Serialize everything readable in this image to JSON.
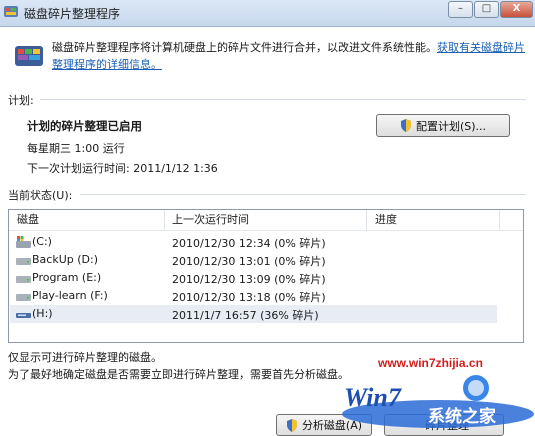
{
  "window": {
    "title": "磁盘碎片整理程序",
    "controls": {
      "minimize": "–",
      "maximize": "□",
      "close": "X"
    }
  },
  "header": {
    "description": "磁盘碎片整理程序将计算机硬盘上的碎片文件进行合并，以改进文件系统性能。",
    "link_text": "获取有关磁盘碎片整理程序的详细信息。"
  },
  "schedule": {
    "section_label": "计划:",
    "status_title": "计划的碎片整理已启用",
    "frequency": "每星期三 1:00 运行",
    "next_run": "下一次计划运行时间: 2011/1/12 1:36",
    "configure_button": "配置计划(S)..."
  },
  "current_status": {
    "section_label": "当前状态(U):",
    "columns": [
      "磁盘",
      "上一次运行时间",
      "进度"
    ],
    "disks": [
      {
        "name": "(C:)",
        "last_run": "2010/12/30 12:34 (0% 碎片)",
        "progress": "",
        "icon": "system-drive-icon"
      },
      {
        "name": "BackUp (D:)",
        "last_run": "2010/12/30 13:01 (0% 碎片)",
        "progress": "",
        "icon": "hard-drive-icon"
      },
      {
        "name": "Program (E:)",
        "last_run": "2010/12/30 13:09 (0% 碎片)",
        "progress": "",
        "icon": "hard-drive-icon"
      },
      {
        "name": "Play-learn (F:)",
        "last_run": "2010/12/30 13:18 (0% 碎片)",
        "progress": "",
        "icon": "hard-drive-icon"
      },
      {
        "name": "(H:)",
        "last_run": "2011/1/7 16:57 (36% 碎片)",
        "progress": "",
        "icon": "removable-drive-icon"
      }
    ],
    "selected_index": 4
  },
  "footer": {
    "note1": "仅显示可进行碎片整理的磁盘。",
    "note2": "为了最好地确定磁盘是否需要立即进行碎片整理，需要首先分析磁盘。",
    "analyze_button": "分析磁盘(A)",
    "defrag_button_partial": "碎片整理"
  },
  "watermark": {
    "url": "www.win7zhijia.cn",
    "logo_text": "Win7",
    "brand": "系统之家"
  },
  "colors": {
    "accent_link": "#1a5fb4",
    "watermark_red": "#d21e1e",
    "selection": "#e8edf3"
  }
}
